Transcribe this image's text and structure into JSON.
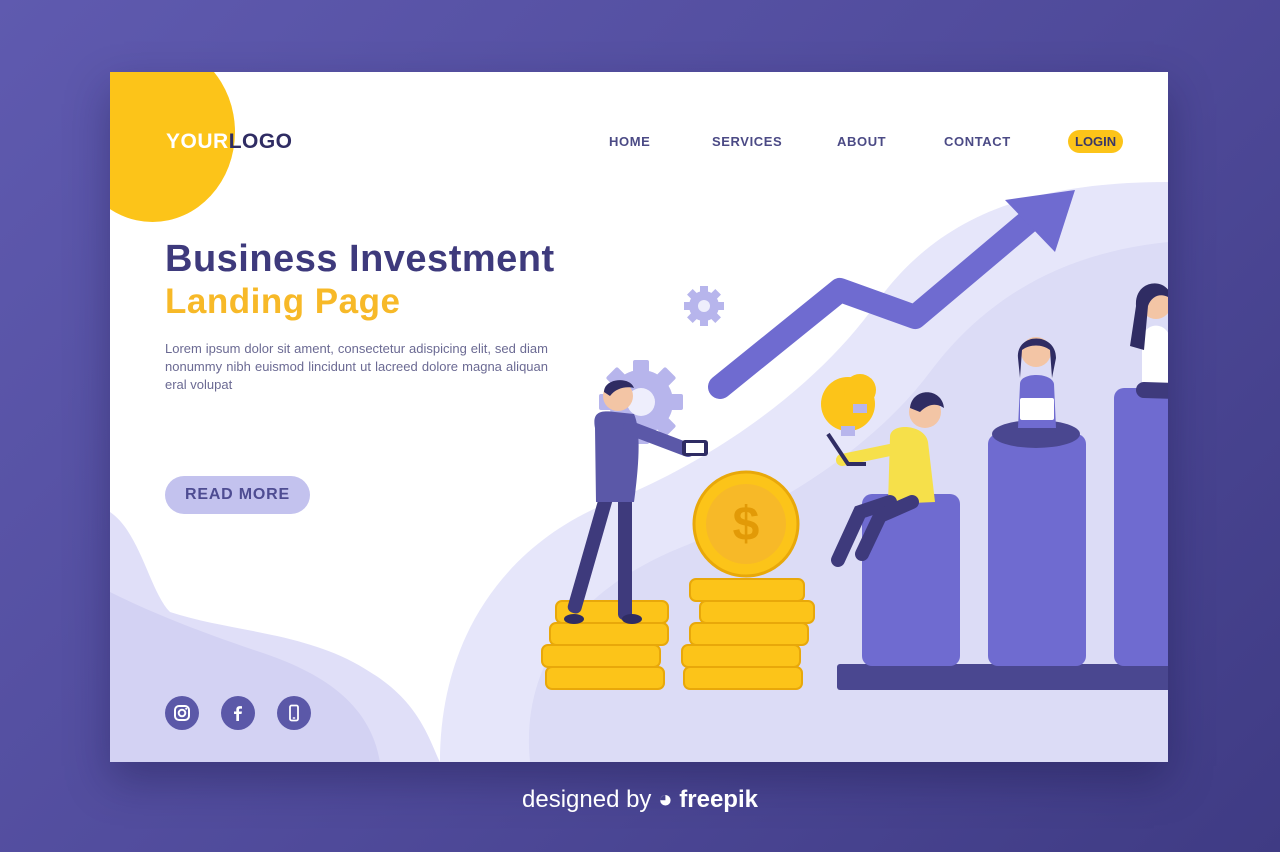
{
  "logo": {
    "part1": "YOUR",
    "part2": "LOGO"
  },
  "nav": {
    "items": [
      {
        "label": "HOME"
      },
      {
        "label": "SERVICES"
      },
      {
        "label": "ABOUT"
      },
      {
        "label": "CONTACT"
      }
    ],
    "login": "LOGIN"
  },
  "hero": {
    "title": "Business Investment",
    "subtitle": "Landing Page",
    "body": "Lorem ipsum dolor sit ament, consectetur adispicing elit, sed diam nonummy nibh euismod lincidunt ut lacreed dolore magna aliquan eral volupat",
    "cta": "READ MORE"
  },
  "social": [
    {
      "icon": "instagram-icon"
    },
    {
      "icon": "facebook-icon"
    },
    {
      "icon": "mobile-phone-icon"
    }
  ],
  "illustration": {
    "coin_symbol": "$"
  },
  "footer": {
    "prefix": "designed by",
    "brand": "freepik"
  },
  "colors": {
    "background": "#5f5aaf",
    "navy": "#3e3a7c",
    "accent_yellow": "#fcc419",
    "orange_text": "#f7b928",
    "lavender": "#c3c2ee",
    "bar_purple": "#6f6bd0"
  }
}
